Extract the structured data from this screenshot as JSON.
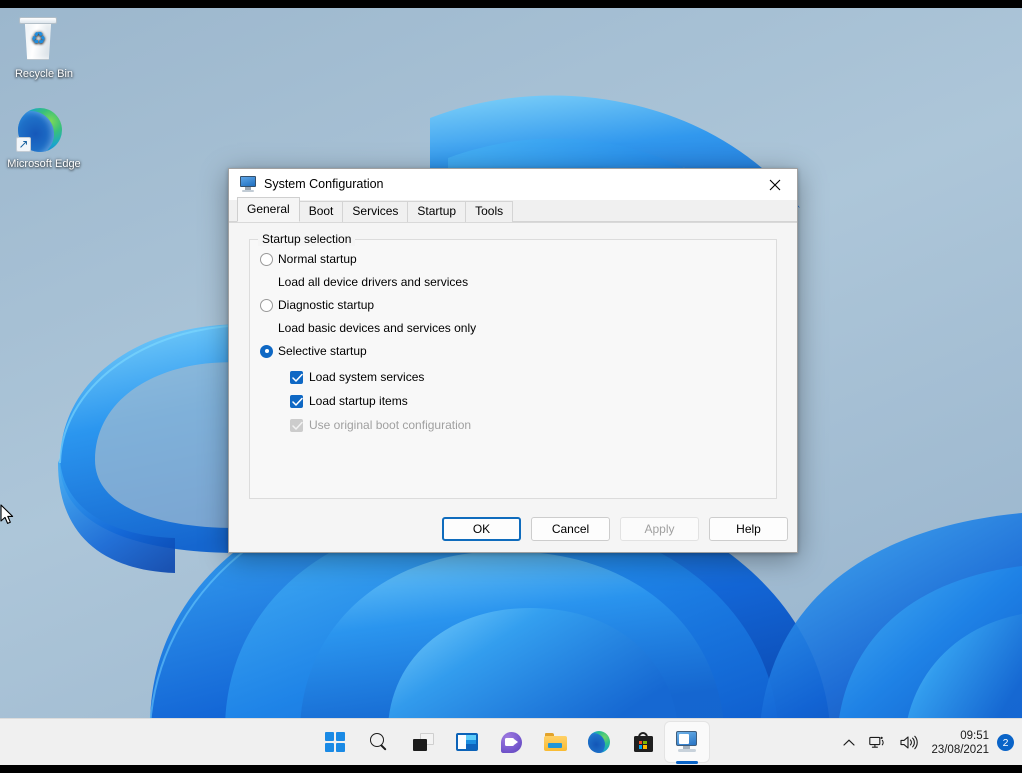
{
  "desktop": {
    "icons": [
      {
        "name": "recycle-bin",
        "label": "Recycle Bin"
      },
      {
        "name": "microsoft-edge",
        "label": "Microsoft\nEdge",
        "label_line1": "Microsoft",
        "label_line2": "Edge"
      }
    ]
  },
  "dialog": {
    "title": "System Configuration",
    "close_label": "✕",
    "tabs": [
      {
        "label": "General",
        "active": true
      },
      {
        "label": "Boot",
        "active": false
      },
      {
        "label": "Services",
        "active": false
      },
      {
        "label": "Startup",
        "active": false
      },
      {
        "label": "Tools",
        "active": false
      }
    ],
    "group": {
      "legend": "Startup selection",
      "options": [
        {
          "label": "Normal startup",
          "desc": "Load all device drivers and services",
          "selected": false
        },
        {
          "label": "Diagnostic startup",
          "desc": "Load basic devices and services only",
          "selected": false
        },
        {
          "label": "Selective startup",
          "desc": "",
          "selected": true
        }
      ],
      "checkboxes": [
        {
          "label": "Load system services",
          "checked": true,
          "disabled": false
        },
        {
          "label": "Load startup items",
          "checked": true,
          "disabled": false
        },
        {
          "label": "Use original boot configuration",
          "checked": true,
          "disabled": true
        }
      ]
    },
    "buttons": [
      {
        "label": "OK",
        "state": "default"
      },
      {
        "label": "Cancel",
        "state": "normal"
      },
      {
        "label": "Apply",
        "state": "disabled"
      },
      {
        "label": "Help",
        "state": "normal"
      }
    ]
  },
  "taskbar": {
    "items": [
      {
        "name": "start",
        "label": "Start"
      },
      {
        "name": "search",
        "label": "Search"
      },
      {
        "name": "task-view",
        "label": "Task View"
      },
      {
        "name": "widgets",
        "label": "Widgets"
      },
      {
        "name": "chat",
        "label": "Chat"
      },
      {
        "name": "file-explorer",
        "label": "File Explorer"
      },
      {
        "name": "microsoft-edge",
        "label": "Microsoft Edge"
      },
      {
        "name": "microsoft-store",
        "label": "Microsoft Store"
      },
      {
        "name": "system-configuration",
        "label": "System Configuration",
        "active": true
      }
    ],
    "tray": {
      "show_hidden_label": "∧",
      "network_label": "Network",
      "volume_label": "Volume",
      "time": "09:51",
      "date": "23/08/2021",
      "notification_count": "2"
    }
  },
  "colors": {
    "accent": "#0a64c8",
    "checkbox_blue": "#0f68c4",
    "focus_border": "#0f6cbd",
    "taskbar_bg": "#f0f0f0",
    "dialog_bg": "#f5f5f5",
    "desktop_base": "#a8c2d6"
  }
}
